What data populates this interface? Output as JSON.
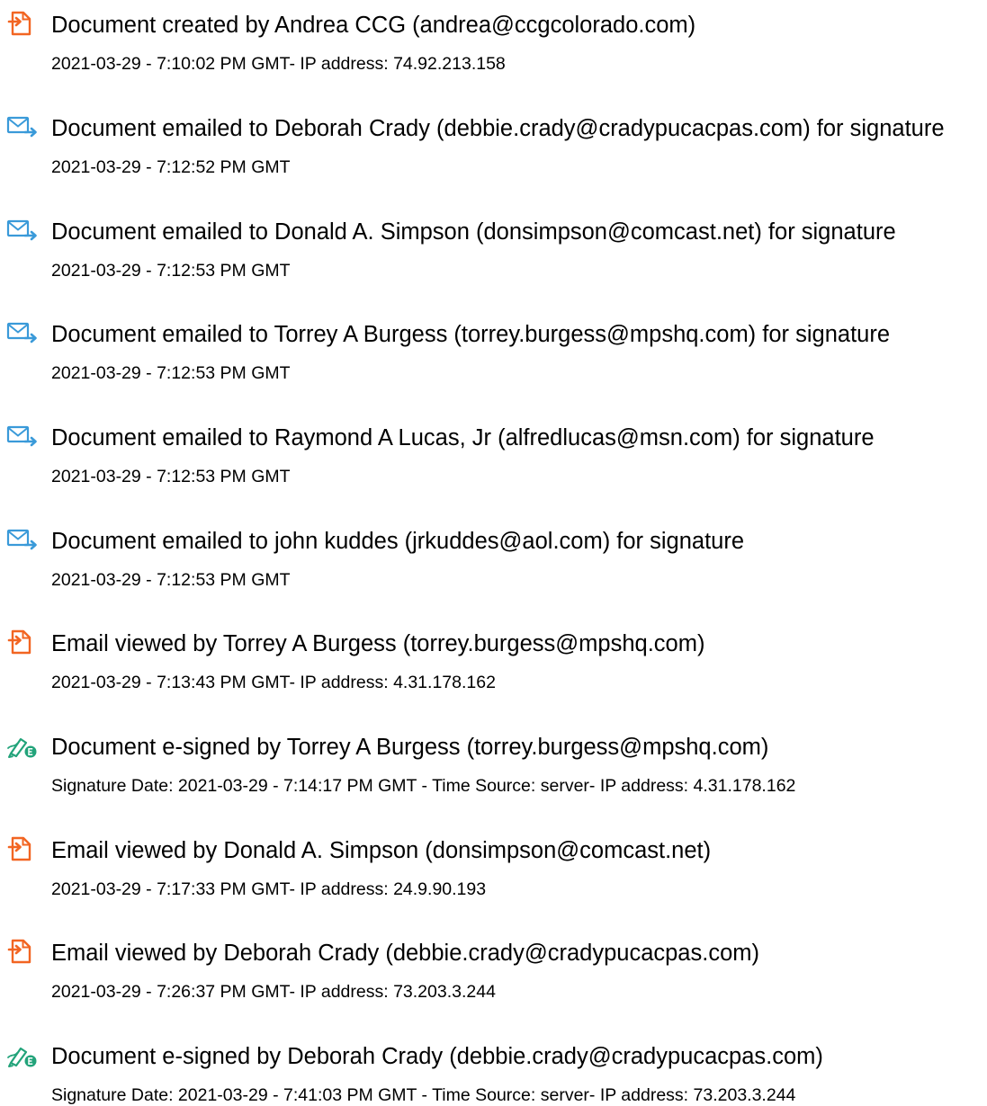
{
  "colors": {
    "created_icon": "#f26522",
    "viewed_icon": "#f26522",
    "email_icon": "#3a9ad9",
    "signed_icon": "#22a37a",
    "text": "#000000"
  },
  "events": [
    {
      "icon": "document-created-icon",
      "title": "Document created by Andrea CCG (andrea@ccgcolorado.com)",
      "detail": "2021-03-29 - 7:10:02 PM GMT- IP address: 74.92.213.158"
    },
    {
      "icon": "email-sent-icon",
      "title": "Document emailed to Deborah Crady (debbie.crady@cradypucacpas.com) for signature",
      "detail": "2021-03-29 - 7:12:52 PM GMT"
    },
    {
      "icon": "email-sent-icon",
      "title": "Document emailed to Donald A. Simpson (donsimpson@comcast.net) for signature",
      "detail": "2021-03-29 - 7:12:53 PM GMT"
    },
    {
      "icon": "email-sent-icon",
      "title": "Document emailed to Torrey A Burgess (torrey.burgess@mpshq.com) for signature",
      "detail": "2021-03-29 - 7:12:53 PM GMT"
    },
    {
      "icon": "email-sent-icon",
      "title": "Document emailed to Raymond A Lucas, Jr (alfredlucas@msn.com) for signature",
      "detail": "2021-03-29 - 7:12:53 PM GMT"
    },
    {
      "icon": "email-sent-icon",
      "title": "Document emailed to john kuddes (jrkuddes@aol.com) for signature",
      "detail": "2021-03-29 - 7:12:53 PM GMT"
    },
    {
      "icon": "email-viewed-icon",
      "title": "Email viewed by Torrey A Burgess (torrey.burgess@mpshq.com)",
      "detail": "2021-03-29 - 7:13:43 PM GMT- IP address: 4.31.178.162"
    },
    {
      "icon": "e-signed-icon",
      "title": "Document e-signed by Torrey A Burgess (torrey.burgess@mpshq.com)",
      "detail": "Signature Date: 2021-03-29 - 7:14:17 PM GMT - Time Source: server- IP address: 4.31.178.162"
    },
    {
      "icon": "email-viewed-icon",
      "title": "Email viewed by Donald A. Simpson (donsimpson@comcast.net)",
      "detail": "2021-03-29 - 7:17:33 PM GMT- IP address: 24.9.90.193"
    },
    {
      "icon": "email-viewed-icon",
      "title": "Email viewed by Deborah Crady (debbie.crady@cradypucacpas.com)",
      "detail": "2021-03-29 - 7:26:37 PM GMT- IP address: 73.203.3.244"
    },
    {
      "icon": "e-signed-icon",
      "title": "Document e-signed by Deborah Crady (debbie.crady@cradypucacpas.com)",
      "detail": "Signature Date: 2021-03-29 - 7:41:03 PM GMT - Time Source: server- IP address: 73.203.3.244"
    }
  ]
}
